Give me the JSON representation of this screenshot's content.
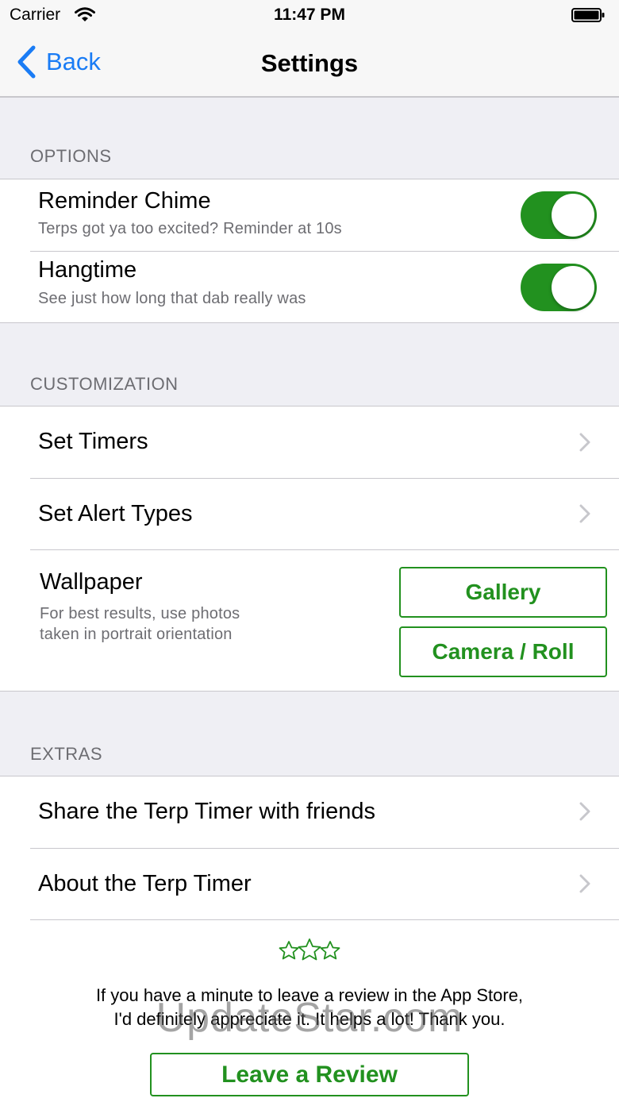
{
  "status_bar": {
    "carrier": "Carrier",
    "time": "11:47 PM"
  },
  "nav": {
    "back_label": "Back",
    "title": "Settings"
  },
  "sections": {
    "options": {
      "header": "OPTIONS",
      "rows": [
        {
          "title": "Reminder Chime",
          "subtitle": "Terps got ya too excited? Reminder at 10s",
          "enabled": true
        },
        {
          "title": "Hangtime",
          "subtitle": "See just how long that dab really was",
          "enabled": true
        }
      ]
    },
    "customization": {
      "header": "CUSTOMIZATION",
      "set_timers": "Set Timers",
      "set_alert_types": "Set Alert Types",
      "wallpaper": {
        "title": "Wallpaper",
        "subtitle_line1": "For best results, use photos",
        "subtitle_line2": "taken in portrait orientation",
        "gallery_button": "Gallery",
        "camera_button": "Camera / Roll"
      }
    },
    "extras": {
      "header": "EXTRAS",
      "share": "Share the Terp Timer with friends",
      "about": "About the Terp Timer"
    }
  },
  "review": {
    "line1": "If you have a minute to leave a review in the App Store,",
    "line2": "I'd definitely appreciate it. It helps a lot! Thank you.",
    "button": "Leave a Review"
  },
  "watermark": "UpdateStar.com",
  "colors": {
    "accent_green": "#22911f",
    "link_blue": "#1a7cf5",
    "grouped_background": "#efeff4"
  }
}
